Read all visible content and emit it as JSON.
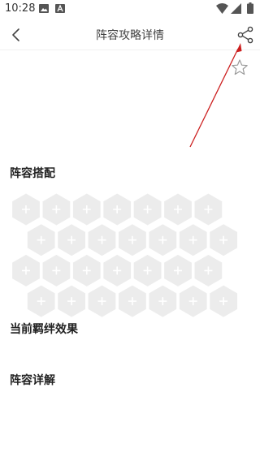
{
  "status_bar": {
    "time": "10:28",
    "icons": [
      "image-icon",
      "font-icon",
      "wifi-icon",
      "signal-icon",
      "battery-icon"
    ]
  },
  "header": {
    "title": "阵容攻略详情",
    "back_icon": "chevron-left-icon",
    "share_icon": "share-icon"
  },
  "favorite_icon": "star-outline-icon",
  "annotation": {
    "arrow_color": "#cc1e1e"
  },
  "sections": {
    "lineup_title": "阵容搭配",
    "bond_title": "当前羁绊效果",
    "detail_title": "阵容详解"
  },
  "lineup_grid": {
    "rows": 4,
    "columns": 7,
    "slot_color": "#ececec",
    "plus_color": "#ffffff",
    "slot_icon": "plus-icon"
  },
  "colors": {
    "accent_arrow": "#cc1e1e",
    "text_primary": "#222222",
    "text_title": "#444444"
  }
}
